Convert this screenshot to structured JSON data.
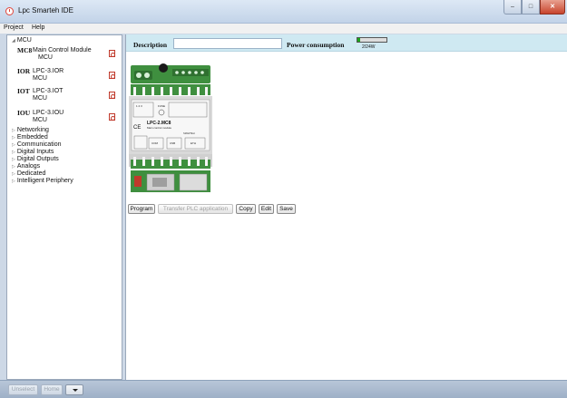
{
  "window": {
    "title": "Lpc Smarteh IDE",
    "minimize": "–",
    "maximize": "□",
    "close": "✕"
  },
  "menu": [
    {
      "label": "Project"
    },
    {
      "label": "Help"
    }
  ],
  "tree": {
    "root": {
      "label": "MCU",
      "icon": "triangle-expanded-icon"
    },
    "nodes": [
      {
        "code": "MC8",
        "name": "Main Control Module",
        "sub": "MCU",
        "icon": "pdf-icon"
      },
      {
        "code": "IOR",
        "name": "LPC-3.IOR",
        "sub": "MCU",
        "icon": "pdf-icon"
      },
      {
        "code": "IOT",
        "name": "LPC-3.IOT",
        "sub": "MCU",
        "icon": "pdf-icon"
      },
      {
        "code": "IOU",
        "name": "LPC-3.IOU",
        "sub": "MCU",
        "icon": "pdf-icon"
      }
    ],
    "categories": [
      {
        "label": "Networking"
      },
      {
        "label": "Embedded"
      },
      {
        "label": "Communication"
      },
      {
        "label": "Digital Inputs"
      },
      {
        "label": "Digital Outputs"
      },
      {
        "label": "Analogs"
      },
      {
        "label": "Dedicated"
      },
      {
        "label": "Intelligent Periphery"
      }
    ]
  },
  "properties": {
    "description_label": "Description",
    "description_value": "",
    "power_label": "Power consumption",
    "power_value": "2/24W",
    "power_fraction": 0.083,
    "power_color": "#1aa61a"
  },
  "module": {
    "model": "LPC-2.MC8",
    "subtitle": "Main control module",
    "brand": "SMARTEH",
    "terminals_top": "1  2  3",
    "fuse": "FUSE",
    "ports": [
      "COM",
      "USB",
      "ETH"
    ]
  },
  "actions": [
    {
      "label": "Program",
      "enabled": true
    },
    {
      "label": "Transfer PLC application",
      "enabled": false
    },
    {
      "label": "Copy",
      "enabled": true
    },
    {
      "label": "Edit",
      "enabled": true
    },
    {
      "label": "Save",
      "enabled": true
    }
  ],
  "statusbar": {
    "unselect": "Unselect",
    "home": "Home"
  }
}
